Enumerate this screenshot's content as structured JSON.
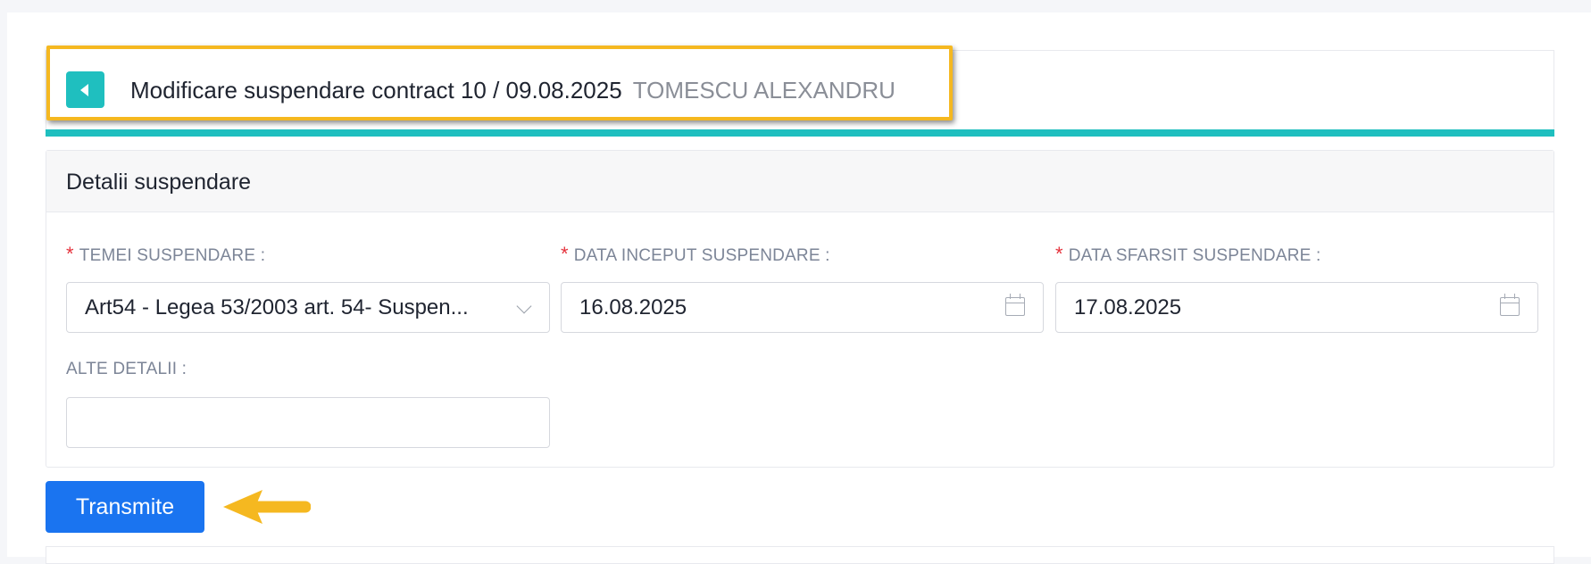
{
  "header": {
    "back_icon": "chevron-left-icon",
    "title": "Modificare suspendare contract 10 / 09.08.2025",
    "employee": "TOMESCU ALEXANDRU",
    "accent_color": "#1fbfbf",
    "highlight_color": "#f5b820"
  },
  "details": {
    "title": "Detalii suspendare",
    "fields": {
      "temei": {
        "required": "*",
        "label": "TEMEI SUSPENDARE :",
        "value": "Art54 - Legea 53/2003 art. 54- Suspen...",
        "icon": "chevron-down-icon"
      },
      "data_inceput": {
        "required": "*",
        "label": "DATA INCEPUT SUSPENDARE :",
        "value": "16.08.2025",
        "icon": "calendar-icon"
      },
      "data_sfarsit": {
        "required": "*",
        "label": "DATA SFARSIT SUSPENDARE :",
        "value": "17.08.2025",
        "icon": "calendar-icon"
      },
      "alte_detalii": {
        "label": "ALTE DETALII :",
        "value": ""
      }
    }
  },
  "actions": {
    "submit_label": "Transmite",
    "submit_color": "#1a74f0",
    "pointer_icon": "arrow-left-icon"
  }
}
